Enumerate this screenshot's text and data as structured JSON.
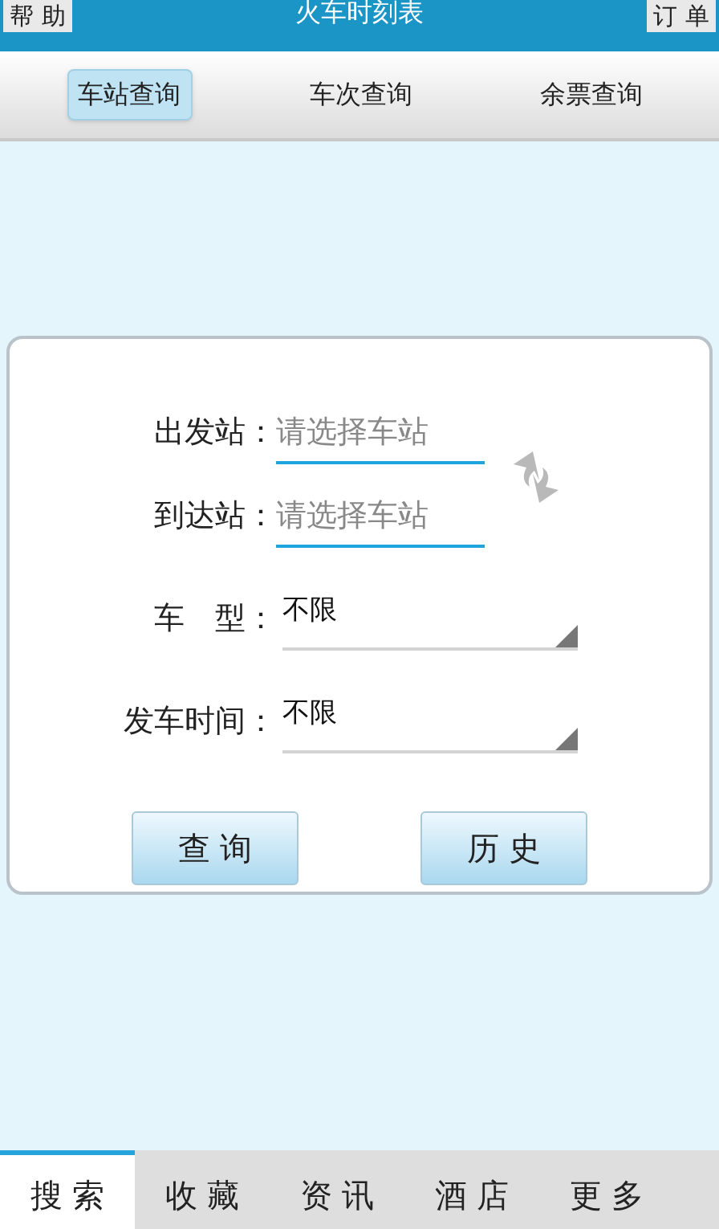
{
  "header": {
    "left_button": "帮 助",
    "title": "火车时刻表",
    "right_button": "订 单"
  },
  "tabs": [
    {
      "label": "车站查询",
      "selected": true
    },
    {
      "label": "车次查询",
      "selected": false
    },
    {
      "label": "余票查询",
      "selected": false
    }
  ],
  "form": {
    "fields": [
      {
        "kind": "input",
        "label": "出发站：",
        "placeholder": "请选择车站"
      },
      {
        "kind": "input",
        "label": "到达站：",
        "placeholder": "请选择车站"
      },
      {
        "kind": "select",
        "label": "车　型：",
        "value": "不限"
      },
      {
        "kind": "select",
        "label": "发车时间：",
        "value": "不限"
      }
    ],
    "buttons": [
      "查 询",
      "历 史"
    ]
  },
  "bottom_tabs": [
    {
      "label": "搜 索",
      "selected": true
    },
    {
      "label": "收 藏",
      "selected": false
    },
    {
      "label": "资 讯",
      "selected": false
    },
    {
      "label": "酒 店",
      "selected": false
    },
    {
      "label": "更 多",
      "selected": false
    }
  ]
}
